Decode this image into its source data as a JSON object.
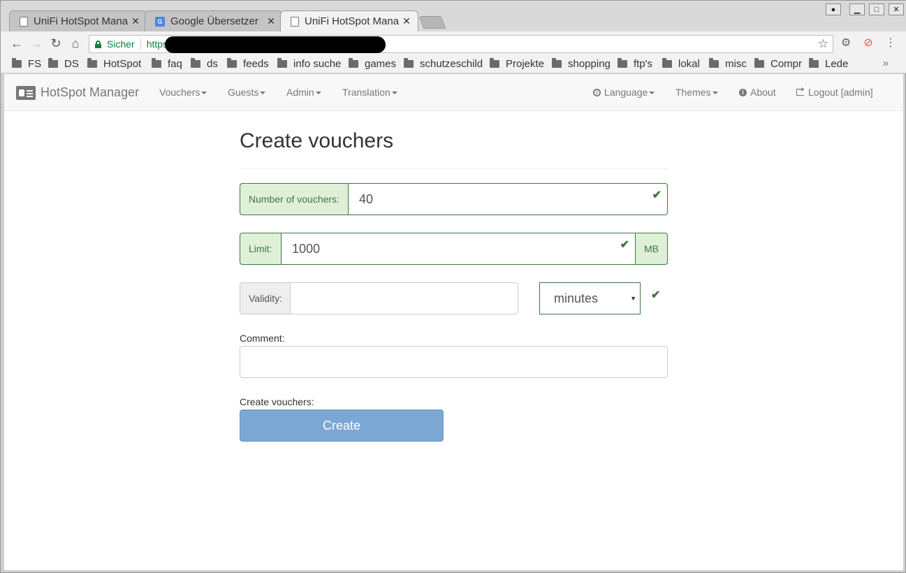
{
  "browser": {
    "tabs": [
      {
        "title": "UniFi HotSpot Mana",
        "close": "✕",
        "icon": "document-icon"
      },
      {
        "title": "Google Übersetzer",
        "close": "✕",
        "icon": "google-translate-icon"
      },
      {
        "title": "UniFi HotSpot Mana",
        "close": "✕",
        "icon": "document-icon"
      }
    ],
    "omnibox": {
      "secure_label": "Sicher",
      "url": "https:"
    },
    "bookmarks": [
      "FS",
      "DS",
      "HotSpot",
      "faq",
      "ds",
      "feeds",
      "info suche",
      "games",
      "schutzeschild",
      "Projekte",
      "shopping",
      "ftp's",
      "lokal",
      "misc",
      "Compr",
      "Lede"
    ],
    "bookmarks_more": "»"
  },
  "navbar": {
    "brand": "HotSpot Manager",
    "left_items": [
      {
        "label": "Vouchers"
      },
      {
        "label": "Guests"
      },
      {
        "label": "Admin"
      },
      {
        "label": "Translation"
      }
    ],
    "right_items": [
      {
        "label": "Language",
        "icon": "globe-icon"
      },
      {
        "label": "Themes"
      },
      {
        "label": "About",
        "icon": "info-icon"
      },
      {
        "label": "Logout [admin]",
        "icon": "logout-icon"
      }
    ]
  },
  "form": {
    "title": "Create vouchers",
    "number_label": "Number of vouchers:",
    "number_value": "40",
    "limit_label": "Limit:",
    "limit_value": "1000",
    "limit_unit": "MB",
    "validity_label": "Validity:",
    "validity_value": "",
    "validity_unit": "minutes",
    "comment_label": "Comment:",
    "create_label": "Create vouchers:",
    "create_button": "Create"
  },
  "colors": {
    "success": "#3c763d",
    "success_bg": "#dff0d8",
    "button": "#7ba7d2"
  }
}
